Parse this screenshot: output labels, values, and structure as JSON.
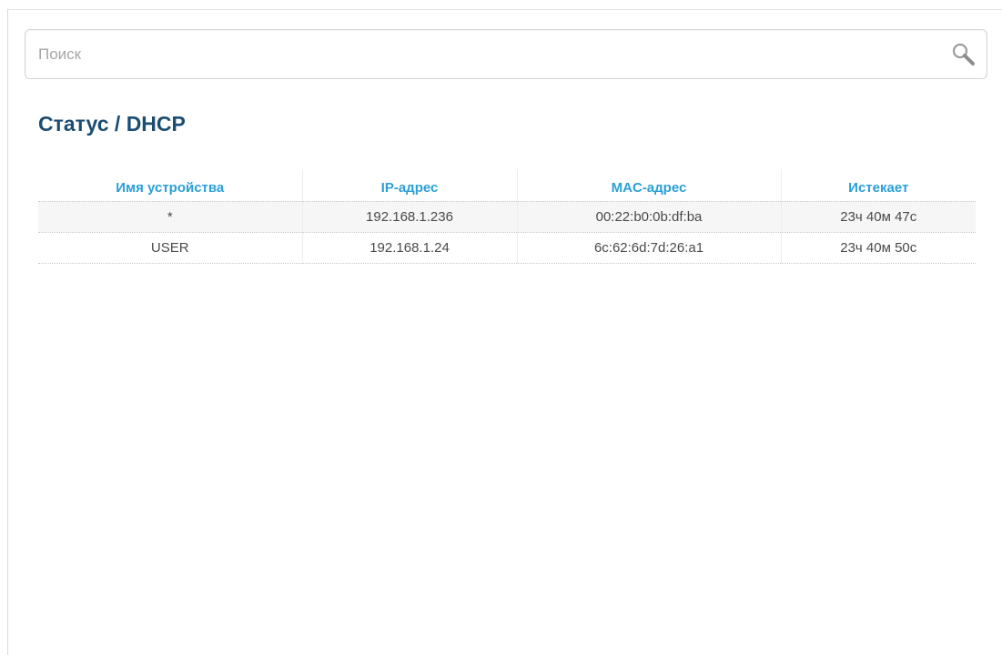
{
  "search": {
    "placeholder": "Поиск",
    "value": "",
    "icon": "search-icon"
  },
  "header": {
    "section": "Статус",
    "separator": " / ",
    "page": "DHCP"
  },
  "table": {
    "columns": [
      "Имя устройства",
      "IP-адрес",
      "MAC-адрес",
      "Истекает"
    ],
    "rows": [
      [
        "*",
        "192.168.1.236",
        "00:22:b0:0b:df:ba",
        "23ч 40м 47с"
      ],
      [
        "USER",
        "192.168.1.24",
        "6c:62:6d:7d:26:a1",
        "23ч 40м 50с"
      ]
    ]
  },
  "colors": {
    "title": "#1b4d72",
    "column_header": "#2a9fd8",
    "cell_text": "#4a4a4a",
    "row_stripe": "#f6f6f6"
  }
}
